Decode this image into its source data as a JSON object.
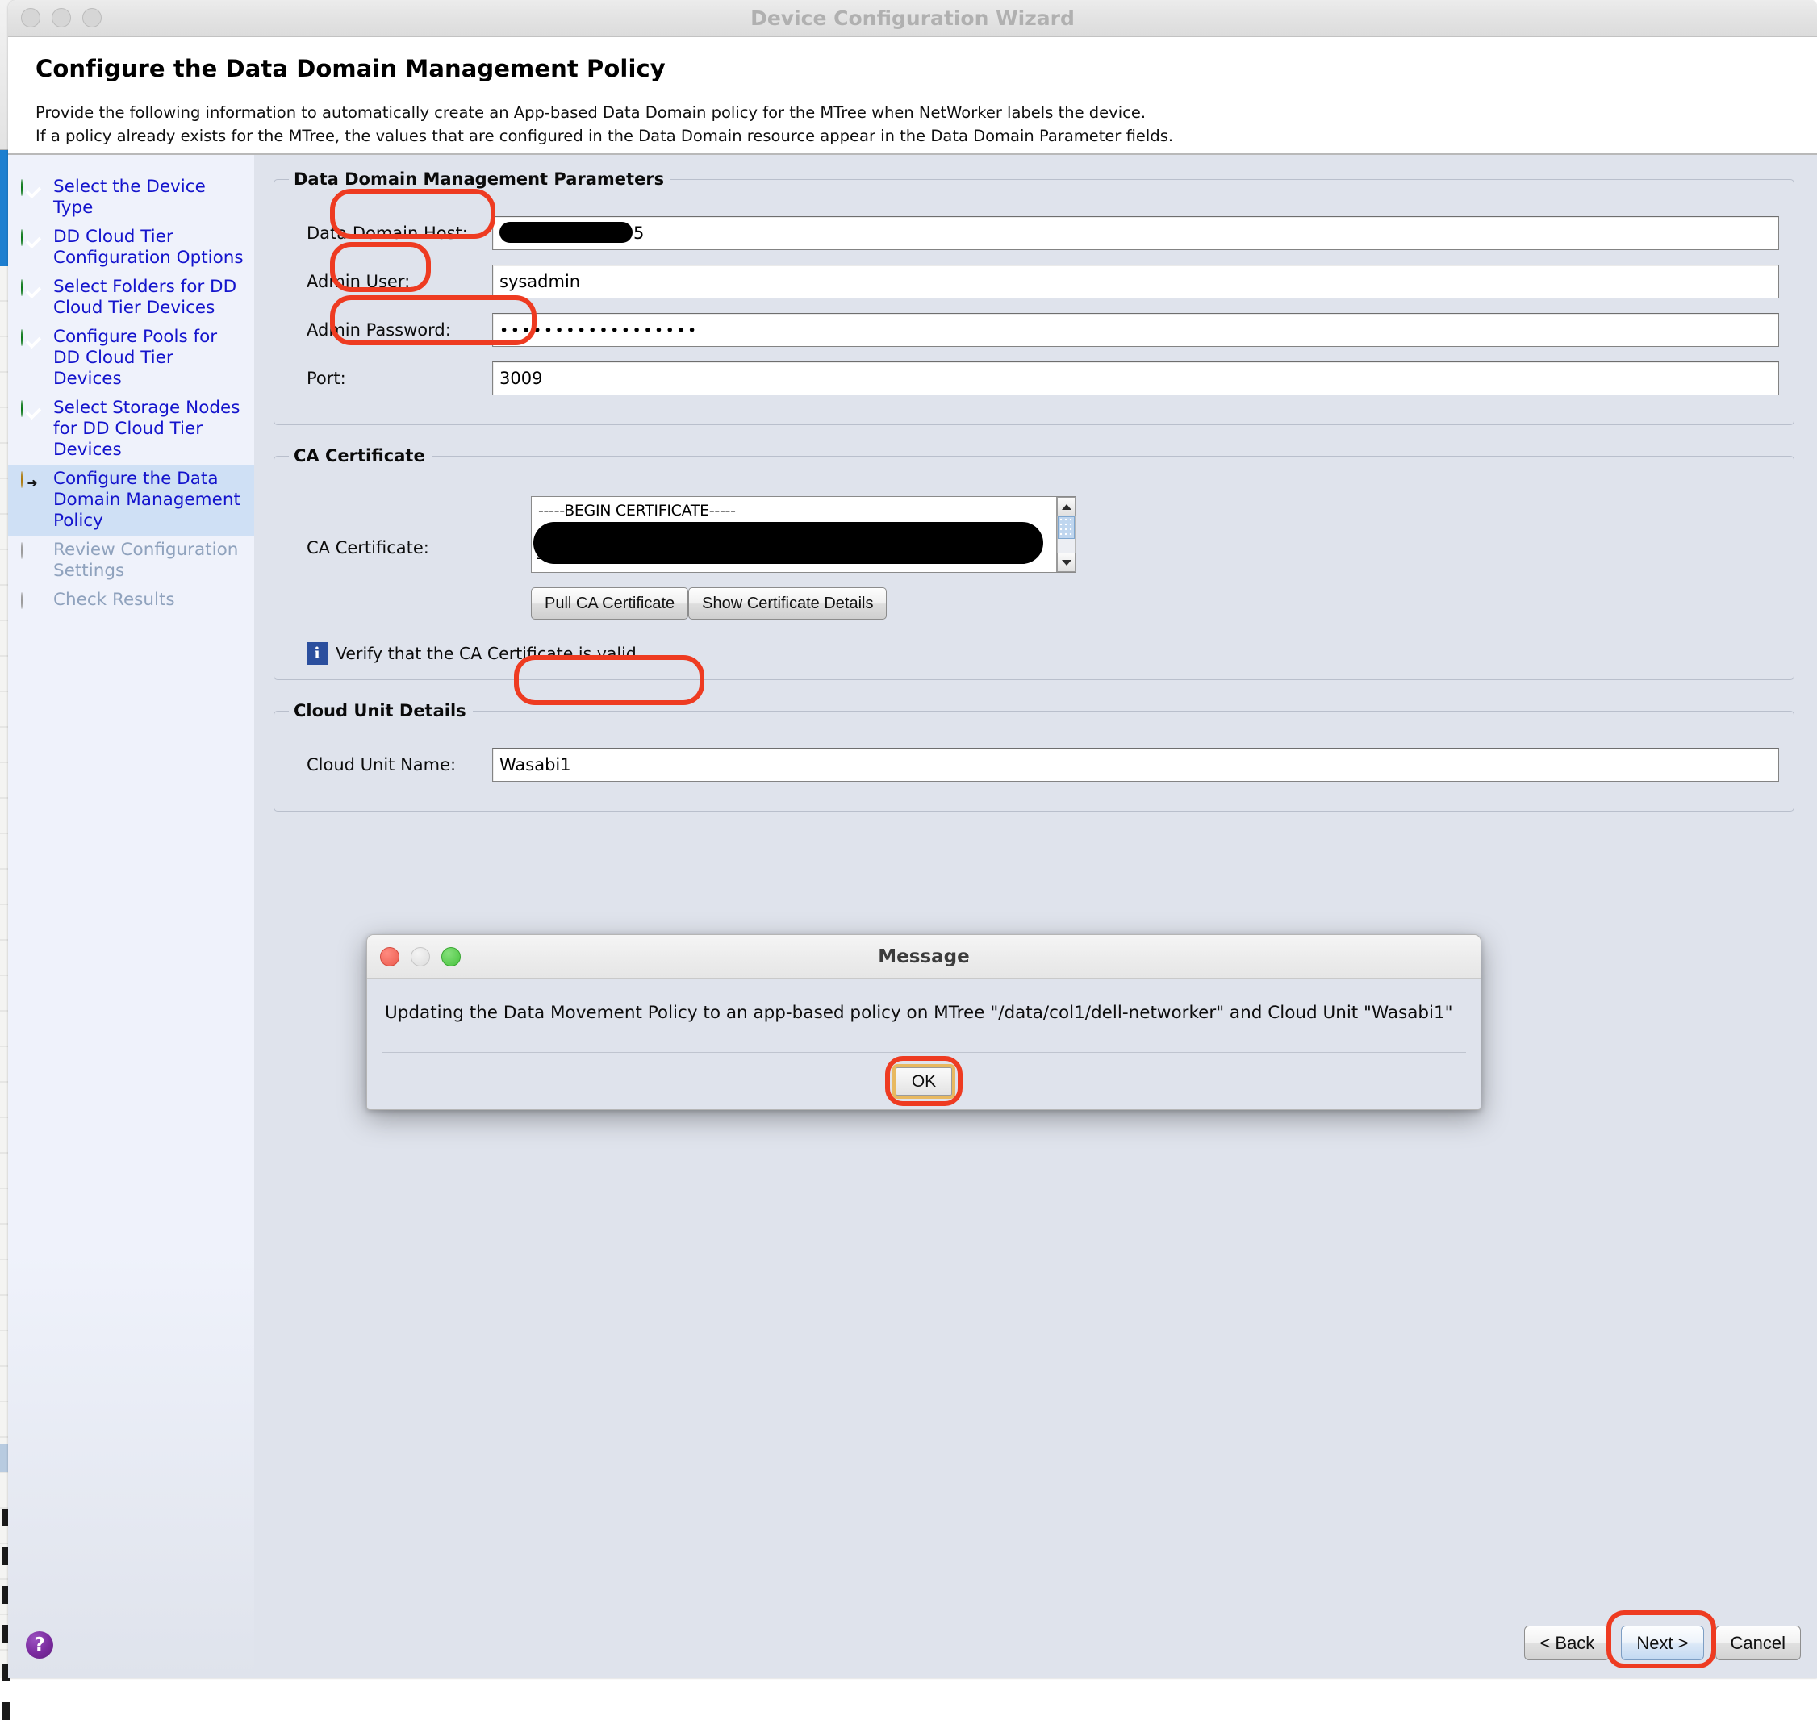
{
  "window": {
    "title": "Device Configuration Wizard",
    "traffic_lights": [
      "close-inactive",
      "minimize-inactive",
      "zoom-inactive"
    ]
  },
  "header": {
    "page_title": "Configure the Data Domain Management Policy",
    "description_line1": "Provide the following information to automatically create an App-based Data Domain policy for the MTree when NetWorker labels the device.",
    "description_line2": "If a policy already exists for the MTree, the values that are configured in the Data Domain resource appear in the Data Domain Parameter fields."
  },
  "sidebar": {
    "steps": [
      {
        "label": "Select the Device Type",
        "state": "done"
      },
      {
        "label": "DD Cloud Tier Configuration Options",
        "state": "done"
      },
      {
        "label": "Select Folders for DD Cloud Tier Devices",
        "state": "done"
      },
      {
        "label": "Configure Pools for DD Cloud Tier Devices",
        "state": "done"
      },
      {
        "label": "Select Storage Nodes for DD Cloud Tier Devices",
        "state": "done"
      },
      {
        "label": "Configure the Data Domain Management Policy",
        "state": "current"
      },
      {
        "label": "Review Configuration Settings",
        "state": "pending"
      },
      {
        "label": "Check Results",
        "state": "pending"
      }
    ]
  },
  "parameters_group": {
    "legend": "Data Domain Management Parameters",
    "fields": [
      {
        "label": "Data Domain Host:",
        "value": "5",
        "redacted": true,
        "highlighted": true
      },
      {
        "label": "Admin User:",
        "value": "sysadmin",
        "redacted": false,
        "highlighted": true
      },
      {
        "label": "Admin Password:",
        "value": "••••••••••••••••••",
        "redacted": false,
        "highlighted": true
      },
      {
        "label": "Port:",
        "value": "3009",
        "redacted": false,
        "highlighted": false
      }
    ]
  },
  "ca_group": {
    "legend": "CA Certificate",
    "field_label": "CA Certificate:",
    "cert_first_line": "-----BEGIN CERTIFICATE-----",
    "cert_trailing_char": "1",
    "pull_button": "Pull CA Certificate",
    "show_details_button": "Show Certificate Details",
    "info_icon": "info-icon",
    "info_text": "Verify that the CA Certificate is valid.",
    "scrollbar": {
      "up_icon": "scroll-up-arrow-icon",
      "down_icon": "scroll-down-arrow-icon"
    }
  },
  "cloud_unit_group": {
    "legend": "Cloud Unit Details",
    "field_label": "Cloud Unit Name:",
    "field_value": "Wasabi1"
  },
  "dialog": {
    "title": "Message",
    "message": "Updating the Data Movement Policy to an app-based policy on MTree \"/data/col1/dell-networker\" and Cloud Unit \"Wasabi1\"",
    "ok_label": "OK",
    "traffic_lights": [
      "close",
      "minimize-disabled",
      "zoom"
    ]
  },
  "footer": {
    "help_icon": "help-question-icon",
    "back_label": "< Back",
    "next_label": "Next >",
    "cancel_label": "Cancel"
  },
  "colors": {
    "highlight_red": "#ee3b21",
    "step_link_blue": "#1414cc",
    "step_pending_gray": "#8fa2bd",
    "panel_bg": "#dfe3ec",
    "current_step_bg": "#cfe0f5",
    "focus_gold": "#e8b960",
    "help_purple": "#7a2a9e",
    "info_blue": "#2b4f9e"
  }
}
